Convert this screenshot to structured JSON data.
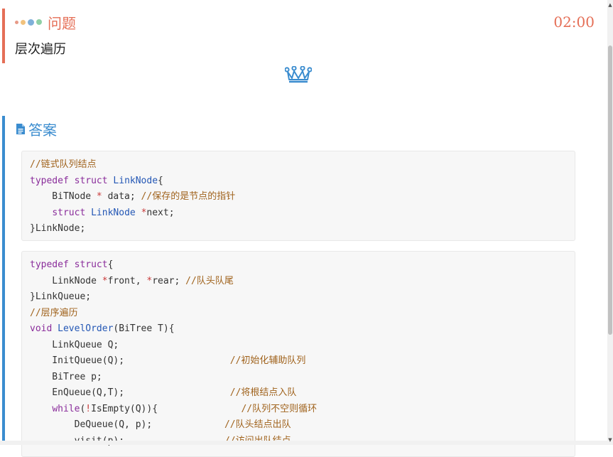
{
  "question": {
    "label": "问题",
    "timer": "02:00",
    "text": "层次遍历",
    "dot_colors": [
      "#e79a87",
      "#f1c27d",
      "#7fb0d9",
      "#8fd0a6"
    ]
  },
  "answer": {
    "label": "答案"
  },
  "icons": {
    "decorative": "dots-icon",
    "reward": "crown-icon",
    "answer": "file-text-icon"
  },
  "colors": {
    "question_accent": "#e56f57",
    "answer_accent": "#3a8ccf",
    "comment": "#a0631d",
    "keyword": "#8a2d9b",
    "type": "#2457b5",
    "operator": "#c83b3b"
  },
  "code_blocks": [
    {
      "lines": [
        [
          {
            "t": "comment",
            "v": "//链式队列结点"
          }
        ],
        [
          {
            "t": "keyword",
            "v": "typedef"
          },
          {
            "t": "plain",
            "v": " "
          },
          {
            "t": "keyword",
            "v": "struct"
          },
          {
            "t": "plain",
            "v": " "
          },
          {
            "t": "type",
            "v": "LinkNode"
          },
          {
            "t": "plain",
            "v": "{"
          }
        ],
        [
          {
            "t": "plain",
            "v": "    BiTNode "
          },
          {
            "t": "op",
            "v": "*"
          },
          {
            "t": "plain",
            "v": " data; "
          },
          {
            "t": "comment",
            "v": "//保存的是节点的指针"
          }
        ],
        [
          {
            "t": "plain",
            "v": "    "
          },
          {
            "t": "keyword",
            "v": "struct"
          },
          {
            "t": "plain",
            "v": " "
          },
          {
            "t": "type",
            "v": "LinkNode"
          },
          {
            "t": "plain",
            "v": " "
          },
          {
            "t": "op",
            "v": "*"
          },
          {
            "t": "plain",
            "v": "next;"
          }
        ],
        [
          {
            "t": "plain",
            "v": "}LinkNode;"
          }
        ]
      ]
    },
    {
      "lines": [
        [
          {
            "t": "keyword",
            "v": "typedef"
          },
          {
            "t": "plain",
            "v": " "
          },
          {
            "t": "keyword",
            "v": "struct"
          },
          {
            "t": "plain",
            "v": "{"
          }
        ],
        [
          {
            "t": "plain",
            "v": "    LinkNode "
          },
          {
            "t": "op",
            "v": "*"
          },
          {
            "t": "plain",
            "v": "front, "
          },
          {
            "t": "op",
            "v": "*"
          },
          {
            "t": "plain",
            "v": "rear; "
          },
          {
            "t": "comment",
            "v": "//队头队尾"
          }
        ],
        [
          {
            "t": "plain",
            "v": "}LinkQueue;"
          }
        ],
        [
          {
            "t": "comment",
            "v": "//层序遍历"
          }
        ],
        [
          {
            "t": "keyword",
            "v": "void"
          },
          {
            "t": "plain",
            "v": " "
          },
          {
            "t": "type",
            "v": "LevelOrder"
          },
          {
            "t": "plain",
            "v": "(BiTree T){"
          }
        ],
        [
          {
            "t": "plain",
            "v": "    LinkQueue Q;"
          }
        ],
        [
          {
            "t": "plain",
            "v": "    InitQueue(Q);                   "
          },
          {
            "t": "comment",
            "v": "//初始化辅助队列"
          }
        ],
        [
          {
            "t": "plain",
            "v": "    BiTree p;"
          }
        ],
        [
          {
            "t": "plain",
            "v": "    EnQueue(Q,T);                   "
          },
          {
            "t": "comment",
            "v": "//将根结点入队"
          }
        ],
        [
          {
            "t": "plain",
            "v": "    "
          },
          {
            "t": "keyword",
            "v": "while"
          },
          {
            "t": "plain",
            "v": "("
          },
          {
            "t": "op",
            "v": "!"
          },
          {
            "t": "plain",
            "v": "IsEmpty(Q)){               "
          },
          {
            "t": "comment",
            "v": "//队列不空则循环"
          }
        ],
        [
          {
            "t": "plain",
            "v": "        DeQueue(Q, p);             "
          },
          {
            "t": "comment",
            "v": "//队头结点出队"
          }
        ],
        [
          {
            "t": "plain",
            "v": "        visit(p);                  "
          },
          {
            "t": "comment",
            "v": "//访问出队结点"
          }
        ]
      ]
    }
  ]
}
